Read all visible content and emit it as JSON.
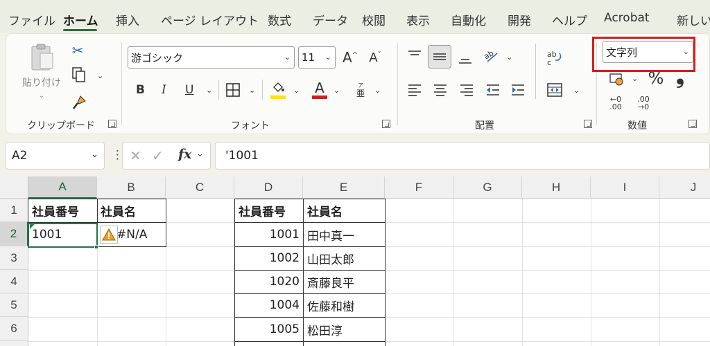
{
  "tabs": [
    "ファイル",
    "ホーム",
    "挿入",
    "ページ レイアウト",
    "数式",
    "データ",
    "校閲",
    "表示",
    "自動化",
    "開発",
    "ヘルプ",
    "Acrobat",
    "新しい"
  ],
  "active_tab": "ホーム",
  "clipboard": {
    "paste_label": "貼り付け",
    "group_label": "クリップボード"
  },
  "font": {
    "name": "游ゴシック",
    "size": "11",
    "group_label": "フォント",
    "bold": "B",
    "italic": "I",
    "underline": "U",
    "font_color_glyph": "A",
    "phonetic_glyph": "亜",
    "phonetic_ruby": "ア"
  },
  "alignment": {
    "group_label": "配置"
  },
  "number": {
    "format_value": "文字列",
    "group_label": "数値",
    "percent": "%",
    "comma": "❟",
    "inc_decimal": "←0\n.00",
    "dec_decimal": ".00\n→0"
  },
  "colors": {
    "accent_green": "#217346",
    "highlight": "#ffe600",
    "font_red": "#d81b1b",
    "callout_red": "#d81b1b",
    "warning": "#f0a020"
  },
  "formula_bar": {
    "name_box": "A2",
    "formula": "'1001",
    "fx": "fx"
  },
  "columns": [
    "A",
    "B",
    "C",
    "D",
    "E",
    "F",
    "G",
    "H",
    "I",
    "J"
  ],
  "rows": [
    "1",
    "2",
    "3",
    "4",
    "5",
    "6"
  ],
  "left_table": {
    "headers": [
      "社員番号",
      "社員名"
    ],
    "row": [
      "1001",
      "#N/A"
    ]
  },
  "right_table": {
    "headers": [
      "社員番号",
      "社員名"
    ],
    "rows": [
      [
        "1001",
        "田中真一"
      ],
      [
        "1002",
        "山田太郎"
      ],
      [
        "1020",
        "斎藤良平"
      ],
      [
        "1004",
        "佐藤和樹"
      ],
      [
        "1005",
        "松田淳"
      ]
    ]
  }
}
